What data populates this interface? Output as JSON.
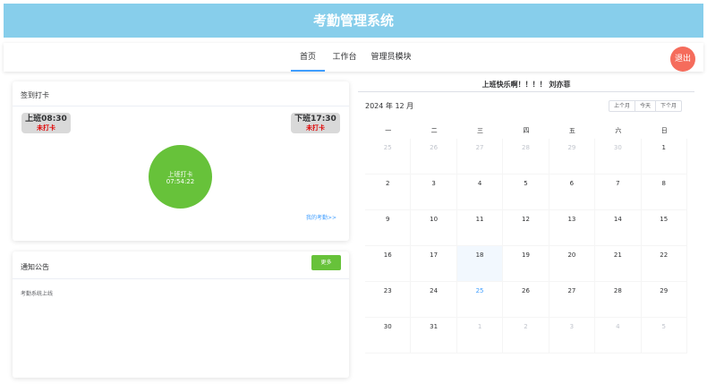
{
  "app": {
    "title": "考勤管理系统"
  },
  "nav": {
    "tabs": [
      "首页",
      "工作台",
      "管理员模块"
    ],
    "active": 0,
    "logout": "退出"
  },
  "checkin": {
    "title": "签到打卡",
    "on_duty": {
      "label": "上班08:30",
      "status": "未打卡"
    },
    "off_duty": {
      "label": "下班17:30",
      "status": "未打卡"
    },
    "button": {
      "label": "上班打卡",
      "time": "07:54:22"
    },
    "my_attendance_link": "我的考勤>>"
  },
  "notice": {
    "title": "通知公告",
    "more": "更多",
    "items": [
      "考勤系统上线"
    ]
  },
  "greeting": "上班快乐啊！！！！ 刘亦菲",
  "calendar": {
    "title": "2024 年 12 月",
    "buttons": [
      "上个月",
      "今天",
      "下个月"
    ],
    "weekdays": [
      "一",
      "二",
      "三",
      "四",
      "五",
      "六",
      "日"
    ],
    "selected": "18",
    "today": "25",
    "weeks": [
      [
        {
          "d": "25",
          "o": true
        },
        {
          "d": "26",
          "o": true
        },
        {
          "d": "27",
          "o": true
        },
        {
          "d": "28",
          "o": true
        },
        {
          "d": "29",
          "o": true
        },
        {
          "d": "30",
          "o": true
        },
        {
          "d": "1",
          "o": false
        }
      ],
      [
        {
          "d": "2",
          "o": false
        },
        {
          "d": "3",
          "o": false
        },
        {
          "d": "4",
          "o": false
        },
        {
          "d": "5",
          "o": false
        },
        {
          "d": "6",
          "o": false
        },
        {
          "d": "7",
          "o": false
        },
        {
          "d": "8",
          "o": false
        }
      ],
      [
        {
          "d": "9",
          "o": false
        },
        {
          "d": "10",
          "o": false
        },
        {
          "d": "11",
          "o": false
        },
        {
          "d": "12",
          "o": false
        },
        {
          "d": "13",
          "o": false
        },
        {
          "d": "14",
          "o": false
        },
        {
          "d": "15",
          "o": false
        }
      ],
      [
        {
          "d": "16",
          "o": false
        },
        {
          "d": "17",
          "o": false
        },
        {
          "d": "18",
          "o": false
        },
        {
          "d": "19",
          "o": false
        },
        {
          "d": "20",
          "o": false
        },
        {
          "d": "21",
          "o": false
        },
        {
          "d": "22",
          "o": false
        }
      ],
      [
        {
          "d": "23",
          "o": false
        },
        {
          "d": "24",
          "o": false
        },
        {
          "d": "25",
          "o": false
        },
        {
          "d": "26",
          "o": false
        },
        {
          "d": "27",
          "o": false
        },
        {
          "d": "28",
          "o": false
        },
        {
          "d": "29",
          "o": false
        }
      ],
      [
        {
          "d": "30",
          "o": false
        },
        {
          "d": "31",
          "o": false
        },
        {
          "d": "1",
          "o": true
        },
        {
          "d": "2",
          "o": true
        },
        {
          "d": "3",
          "o": true
        },
        {
          "d": "4",
          "o": true
        },
        {
          "d": "5",
          "o": true
        }
      ]
    ]
  },
  "colors": {
    "header": "#87ceeb",
    "clock_button": "#67c23a",
    "logout": "#f56c5c",
    "status_red": "#e00000",
    "link": "#409eff"
  }
}
